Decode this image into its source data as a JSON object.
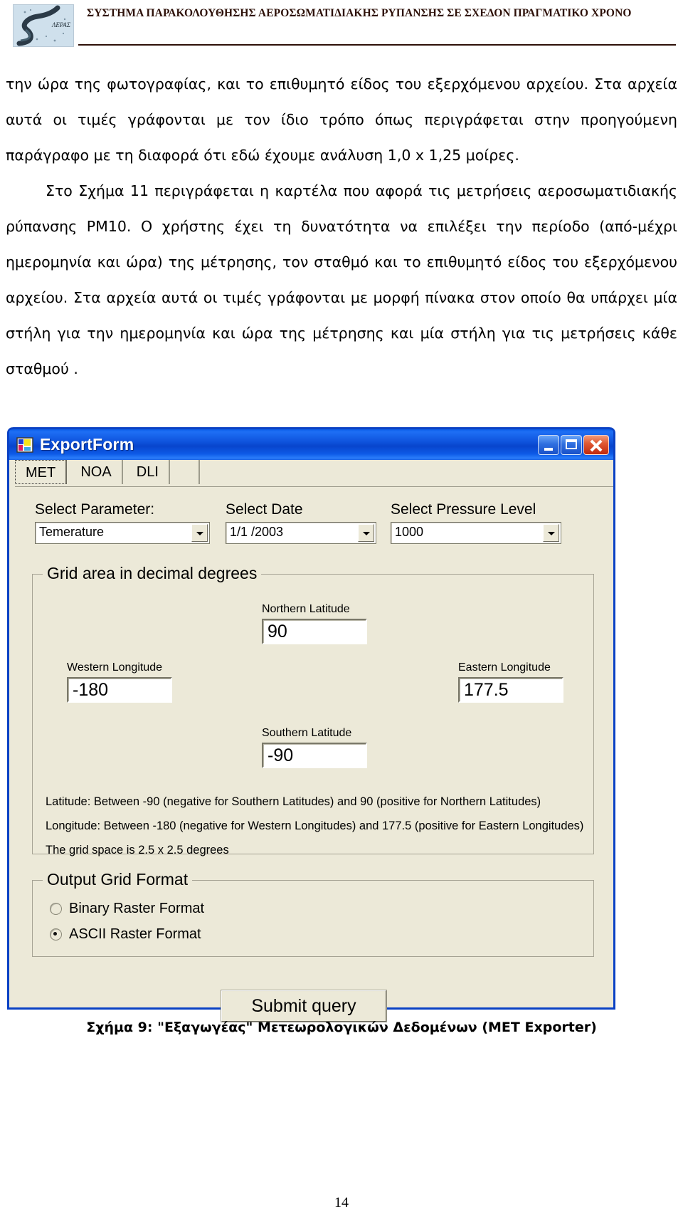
{
  "header": {
    "logo_text": "ΛΕΡΑΣ",
    "title": "ΣΥΣΤΗΜΑ ΠΑΡΑΚΟΛΟΥΘΗΣΗΣ ΑΕΡΟΣΩΜΑΤΙΔΙΑΚΗΣ ΡΥΠΑΝΣΗΣ ΣΕ ΣΧΕΔΟΝ ΠΡΑΓΜΑΤΙΚΟ ΧΡΟΝΟ"
  },
  "body": {
    "paragraph1": "την ώρα της φωτογραφίας, και το επιθυμητό είδος του εξερχόμενου αρχείου. Στα αρχεία αυτά οι τιμές γράφονται με τον ίδιο τρόπο όπως περιγράφεται στην προηγούμενη παράγραφο με τη διαφορά ότι εδώ έχουμε ανάλυση 1,0 x 1,25 μοίρες.",
    "paragraph2": "Στο Σχήμα 11 περιγράφεται η καρτέλα που αφορά τις μετρήσεις αεροσωματιδιακής ρύπανσης PM10. Ο χρήστης έχει τη δυνατότητα να επιλέξει την περίοδο (από-μέχρι ημερομηνία και ώρα) της μέτρησης, τον σταθμό και το επιθυμητό είδος του εξερχόμενου αρχείου. Στα αρχεία αυτά οι τιμές γράφονται με μορφή πίνακα στον οποίο θα υπάρχει μία στήλη για την ημερομηνία και ώρα της μέτρησης και μία στήλη για τις μετρήσεις κάθε σταθμού ."
  },
  "dialog": {
    "title": "ExportForm",
    "window_buttons": {
      "minimize": "minimize-button",
      "maximize": "maximize-button",
      "close": "close-button"
    },
    "tabs": [
      {
        "label": "MET",
        "active": true
      },
      {
        "label": "NOA",
        "active": false
      },
      {
        "label": "DLI",
        "active": false
      }
    ],
    "selectors": [
      {
        "label": "Select Parameter:",
        "value": "Temerature"
      },
      {
        "label": "Select Date",
        "value": "1/1 /2003"
      },
      {
        "label": "Select Pressure Level",
        "value": "1000"
      }
    ],
    "grid_group": {
      "title": "Grid area in decimal degrees",
      "fields": [
        {
          "label": "Northern Latitude",
          "value": "90"
        },
        {
          "label": "Western Longitude",
          "value": "-180"
        },
        {
          "label": "Eastern Longitude",
          "value": "177.5"
        },
        {
          "label": "Southern Latitude",
          "value": "-90"
        }
      ],
      "hints": [
        "Latitude: Between -90 (negative for Southern Latitudes)  and 90 (positive for Northern Latitudes)",
        "Longitude: Between -180 (negative for Western Longitudes) and 177.5 (positive for Eastern Longitudes)",
        "The grid space is 2.5 x 2.5 degrees"
      ]
    },
    "output_group": {
      "title": "Output Grid Format",
      "options": [
        {
          "label": "Binary Raster Format",
          "selected": false
        },
        {
          "label": "ASCII Raster Format",
          "selected": true
        }
      ]
    },
    "submit_label": "Submit query"
  },
  "caption": "Σχήμα 9: \"Εξαγωγέας\" Μετεωρολογικών Δεδομένων (MET Exporter)",
  "page_number": "14",
  "colors": {
    "titlebar_blue": "#0a41c4",
    "window_face": "#ece9d8",
    "close_red": "#c0290d"
  }
}
